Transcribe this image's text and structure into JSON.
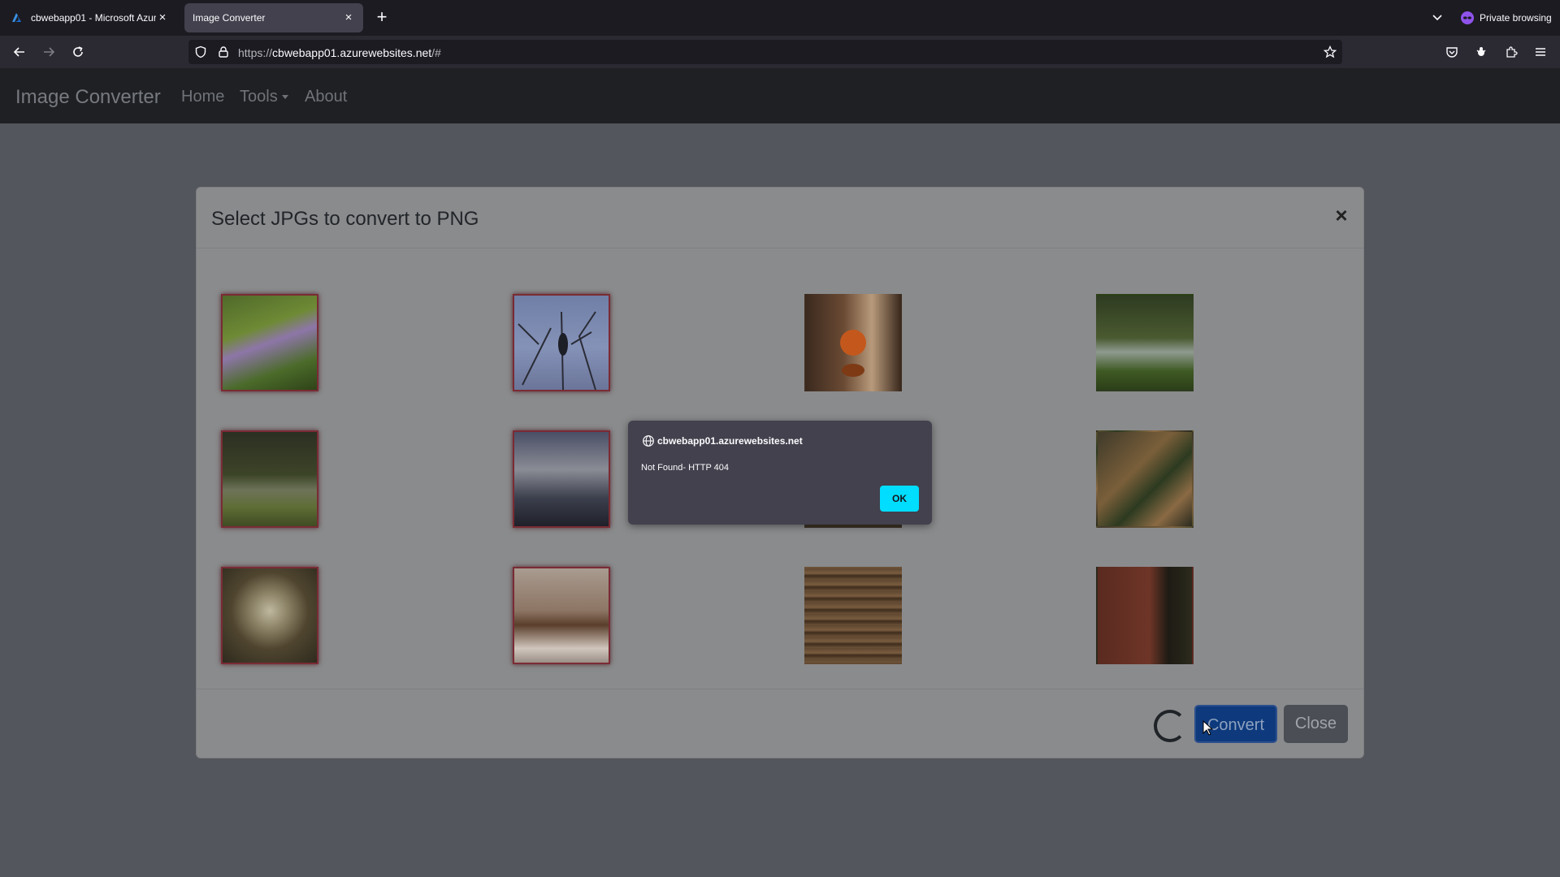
{
  "browser": {
    "tabs": [
      {
        "title": "cbwebapp01 - Microsoft Azure",
        "active": false
      },
      {
        "title": "Image Converter",
        "active": true
      }
    ],
    "private_label": "Private browsing",
    "url_prefix": "https://",
    "url_host": "cbwebapp01.azurewebsites.net",
    "url_path": "/#"
  },
  "app": {
    "brand": "Image Converter",
    "nav": {
      "home": "Home",
      "tools": "Tools",
      "about": "About"
    }
  },
  "modal": {
    "title": "Select JPGs to convert to PNG",
    "close_symbol": "×",
    "convert_label": "Convert",
    "close_label": "Close",
    "images": [
      {
        "subject": "purple lupine flower",
        "selected": true
      },
      {
        "subject": "bird on bare branches",
        "selected": true
      },
      {
        "subject": "orange on table",
        "selected": false
      },
      {
        "subject": "pond fountain",
        "selected": false
      },
      {
        "subject": "forest pond",
        "selected": true
      },
      {
        "subject": "trees against sunset",
        "selected": true
      },
      {
        "subject": "hidden behind dialog",
        "selected": false
      },
      {
        "subject": "roasted chicken with vegetables",
        "selected": false
      },
      {
        "subject": "hanging lamp",
        "selected": true
      },
      {
        "subject": "wooden chair detail",
        "selected": true
      },
      {
        "subject": "stacked wood planks",
        "selected": false
      },
      {
        "subject": "tree trunk and lawn",
        "selected": false
      }
    ]
  },
  "alert": {
    "origin": "cbwebapp01.azurewebsites.net",
    "message": "Not Found- HTTP 404",
    "ok_label": "OK"
  }
}
